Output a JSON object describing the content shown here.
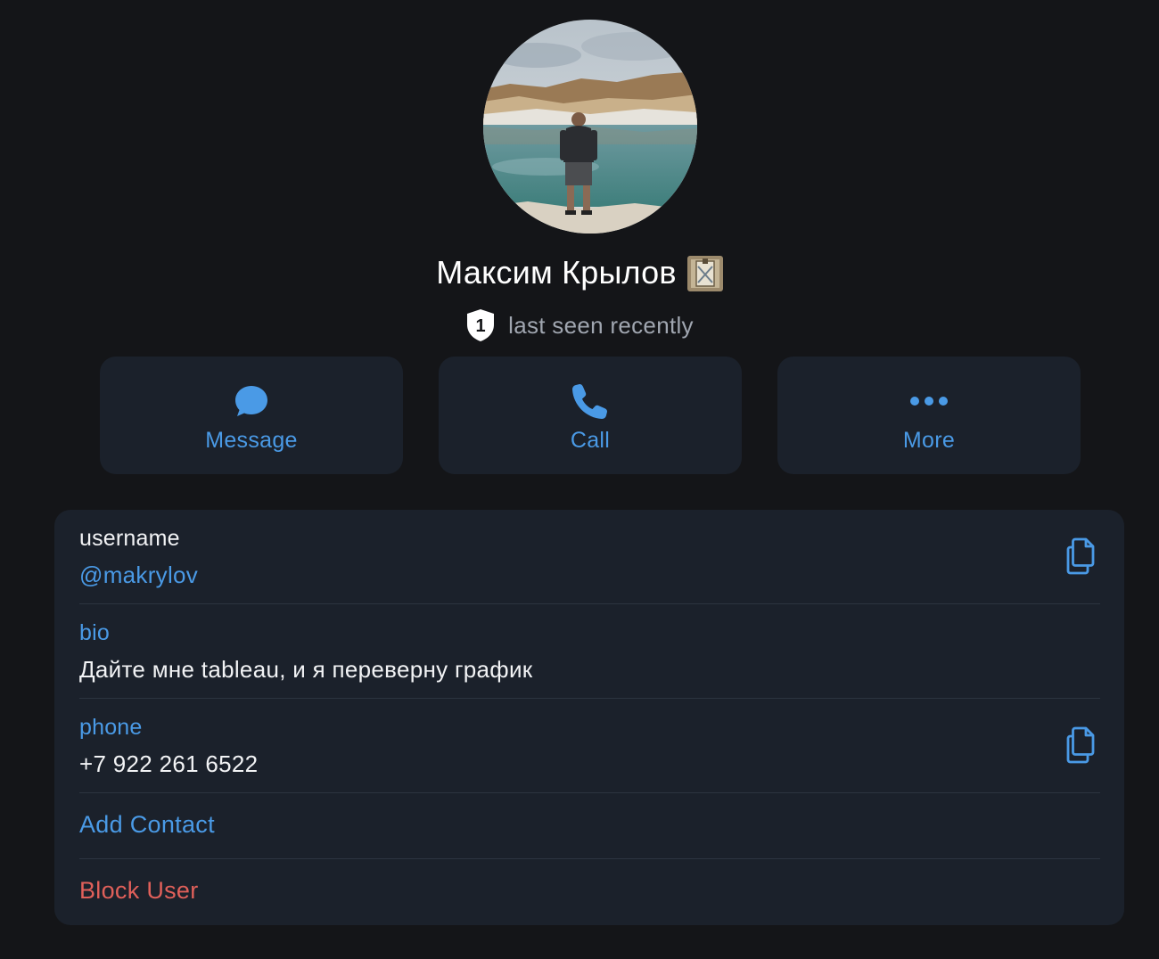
{
  "profile": {
    "name": "Максим Крылов",
    "status": "last seen recently",
    "badge_number": "1"
  },
  "actions": {
    "message_label": "Message",
    "call_label": "Call",
    "more_label": "More"
  },
  "info": {
    "username_label": "username",
    "username_value": "@makrylov",
    "bio_label": "bio",
    "bio_value": "Дайте мне tableau, и я переверну график",
    "phone_label": "phone",
    "phone_value": "+7 922 261 6522",
    "add_contact_label": "Add Contact",
    "block_user_label": "Block User"
  },
  "icons": {
    "message": "message-bubble-icon",
    "call": "phone-icon",
    "more": "more-dots-icon",
    "copy": "copy-icon",
    "badge": "shield-badge-icon",
    "emoji_status": "emoji-status-icon"
  },
  "colors": {
    "background": "#141518",
    "card": "#1b212b",
    "accent": "#4a9ae6",
    "danger": "#e0605a",
    "secondary_text": "#a0a6b0"
  }
}
